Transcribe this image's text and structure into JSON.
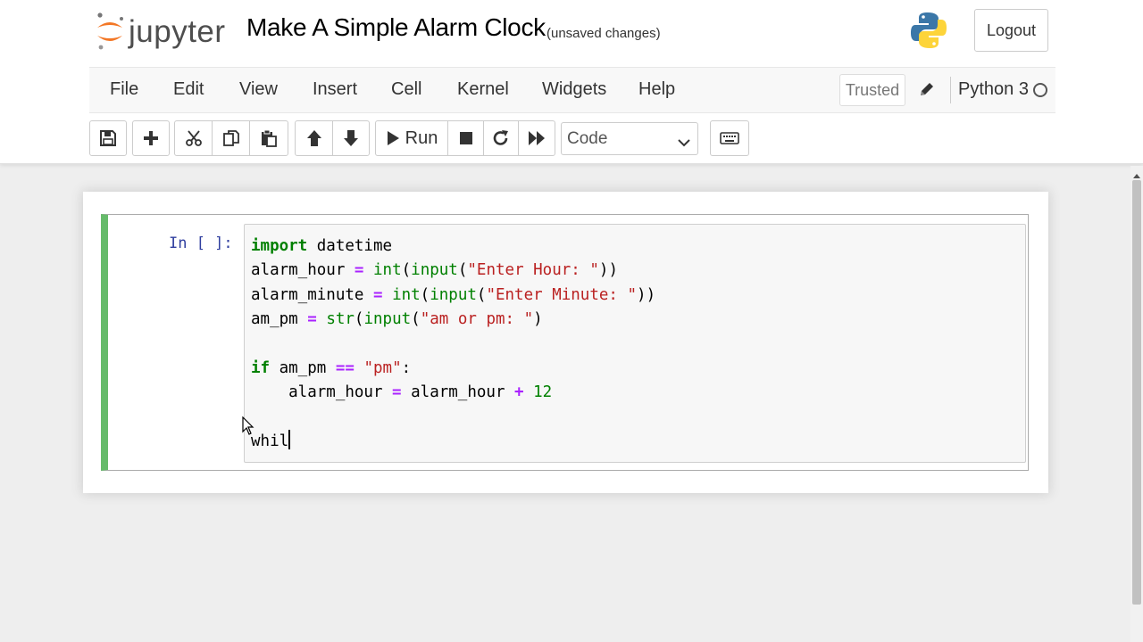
{
  "header": {
    "logo_text": "jupyter",
    "notebook_title": "Make A Simple Alarm Clock",
    "save_status": "(unsaved changes)",
    "logout_label": "Logout"
  },
  "menubar": {
    "items": [
      "File",
      "Edit",
      "View",
      "Insert",
      "Cell",
      "Kernel",
      "Widgets",
      "Help"
    ],
    "trusted_label": "Trusted",
    "kernel_name": "Python 3"
  },
  "toolbar": {
    "run_label": "Run",
    "cell_type": "Code",
    "icons": [
      "save-icon",
      "plus-icon",
      "cut-icon",
      "copy-icon",
      "paste-icon",
      "arrow-up-icon",
      "arrow-down-icon",
      "play-icon",
      "stop-icon",
      "restart-icon",
      "fast-forward-icon",
      "keyboard-icon"
    ]
  },
  "cell": {
    "prompt": "In [ ]:",
    "lines": [
      [
        [
          "kw",
          "import"
        ],
        [
          "",
          " datetime"
        ]
      ],
      [
        [
          "",
          "alarm_hour "
        ],
        [
          "op",
          "="
        ],
        [
          "",
          " "
        ],
        [
          "bi",
          "int"
        ],
        [
          "",
          "("
        ],
        [
          "bi",
          "input"
        ],
        [
          "",
          "("
        ],
        [
          "st",
          "\"Enter Hour: \""
        ],
        [
          "",
          "))"
        ]
      ],
      [
        [
          "",
          "alarm_minute "
        ],
        [
          "op",
          "="
        ],
        [
          "",
          " "
        ],
        [
          "bi",
          "int"
        ],
        [
          "",
          "("
        ],
        [
          "bi",
          "input"
        ],
        [
          "",
          "("
        ],
        [
          "st",
          "\"Enter Minute: \""
        ],
        [
          "",
          "))"
        ]
      ],
      [
        [
          "",
          "am_pm "
        ],
        [
          "op",
          "="
        ],
        [
          "",
          " "
        ],
        [
          "bi",
          "str"
        ],
        [
          "",
          "("
        ],
        [
          "bi",
          "input"
        ],
        [
          "",
          "("
        ],
        [
          "st",
          "\"am or pm: \""
        ],
        [
          "",
          ")"
        ]
      ],
      [],
      [
        [
          "kw",
          "if"
        ],
        [
          "",
          " am_pm "
        ],
        [
          "op",
          "=="
        ],
        [
          "",
          " "
        ],
        [
          "st",
          "\"pm\""
        ],
        [
          "",
          ":"
        ]
      ],
      [
        [
          "",
          "    alarm_hour "
        ],
        [
          "op",
          "="
        ],
        [
          "",
          " alarm_hour "
        ],
        [
          "op",
          "+"
        ],
        [
          "",
          " "
        ],
        [
          "nu",
          "12"
        ]
      ],
      [],
      [
        [
          "",
          "whil"
        ]
      ]
    ]
  },
  "colors": {
    "cell_edit_border": "#66bb6a",
    "prompt_color": "#303f9f",
    "keyword": "#008000",
    "string": "#ba2121",
    "operator": "#aa22ff"
  }
}
